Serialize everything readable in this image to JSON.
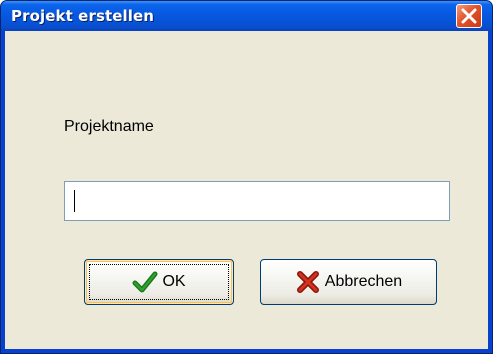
{
  "window": {
    "title": "Projekt erstellen"
  },
  "form": {
    "label": "Projektname",
    "input_value": ""
  },
  "buttons": {
    "ok_label": "OK",
    "cancel_label": "Abbrechen"
  },
  "icons": {
    "close": "close-icon",
    "ok": "checkmark-icon",
    "cancel": "x-cross-icon"
  },
  "colors": {
    "titlebar": "#0a5ce0",
    "close_button": "#e2532a",
    "dialog_background": "#ece9d8",
    "checkmark": "#1c7a1c",
    "cross": "#b81e0e"
  }
}
